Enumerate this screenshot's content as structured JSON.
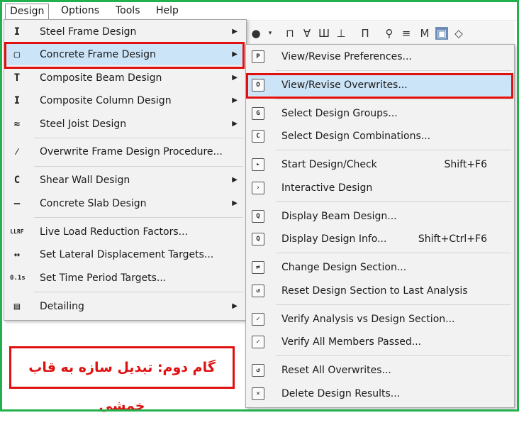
{
  "menubar": {
    "items": [
      "Design",
      "Options",
      "Tools",
      "Help"
    ]
  },
  "design_menu": {
    "items": [
      {
        "label": "Steel Frame Design",
        "icon": "steel-frame-icon",
        "glyph": "I",
        "submenu": true
      },
      {
        "label": "Concrete Frame Design",
        "icon": "concrete-frame-icon",
        "glyph": "▢",
        "submenu": true,
        "highlighted": true
      },
      {
        "label": "Composite Beam Design",
        "icon": "composite-beam-icon",
        "glyph": "T",
        "submenu": true
      },
      {
        "label": "Composite Column Design",
        "icon": "composite-column-icon",
        "glyph": "I",
        "submenu": true
      },
      {
        "label": "Steel Joist Design",
        "icon": "steel-joist-icon",
        "glyph": "≈",
        "submenu": true
      },
      {
        "label": "Overwrite Frame Design Procedure...",
        "icon": "overwrite-procedure-icon",
        "glyph": "⁄",
        "submenu": false
      },
      {
        "label": "Shear Wall Design",
        "icon": "shear-wall-icon",
        "glyph": "C",
        "submenu": true
      },
      {
        "label": "Concrete Slab Design",
        "icon": "concrete-slab-icon",
        "glyph": "—",
        "submenu": true
      },
      {
        "label": "Live Load Reduction Factors...",
        "icon": "llrf-icon",
        "glyph": "LLRF",
        "submenu": false
      },
      {
        "label": "Set Lateral Displacement Targets...",
        "icon": "lateral-displacement-icon",
        "glyph": "↔",
        "submenu": false
      },
      {
        "label": "Set Time Period Targets...",
        "icon": "time-period-icon",
        "glyph": "0.1s",
        "submenu": false
      },
      {
        "label": "Detailing",
        "icon": "detailing-icon",
        "glyph": "▤",
        "submenu": true
      }
    ]
  },
  "concrete_submenu": {
    "items": [
      {
        "label": "View/Revise Preferences...",
        "glyph": "P",
        "shortcut": ""
      },
      {
        "label": "View/Revise Overwrites...",
        "glyph": "O",
        "shortcut": "",
        "highlighted": true
      },
      {
        "label": "Select Design Groups...",
        "glyph": "G",
        "shortcut": ""
      },
      {
        "label": "Select Design Combinations...",
        "glyph": "C",
        "shortcut": ""
      },
      {
        "label": "Start Design/Check",
        "glyph": "▸",
        "shortcut": "Shift+F6"
      },
      {
        "label": "Interactive Design",
        "glyph": "›",
        "shortcut": ""
      },
      {
        "label": "Display Beam Design...",
        "glyph": "Q",
        "shortcut": ""
      },
      {
        "label": "Display Design Info...",
        "glyph": "Q",
        "shortcut": "Shift+Ctrl+F6"
      },
      {
        "label": "Change Design Section...",
        "glyph": "⇄",
        "shortcut": ""
      },
      {
        "label": "Reset Design Section to Last Analysis",
        "glyph": "↺",
        "shortcut": ""
      },
      {
        "label": "Verify Analysis vs Design Section...",
        "glyph": "✓",
        "shortcut": ""
      },
      {
        "label": "Verify All Members Passed...",
        "glyph": "✓",
        "shortcut": ""
      },
      {
        "label": "Reset All Overwrites...",
        "glyph": "↺",
        "shortcut": ""
      },
      {
        "label": "Delete Design Results...",
        "glyph": "✕",
        "shortcut": ""
      }
    ]
  },
  "banner": {
    "text": "گام دوم: تبدیل سازه به قاب خمشی"
  },
  "colors": {
    "highlight": "#cce4f7",
    "annotation_red": "#e01010",
    "frame_green": "#22b14c"
  }
}
